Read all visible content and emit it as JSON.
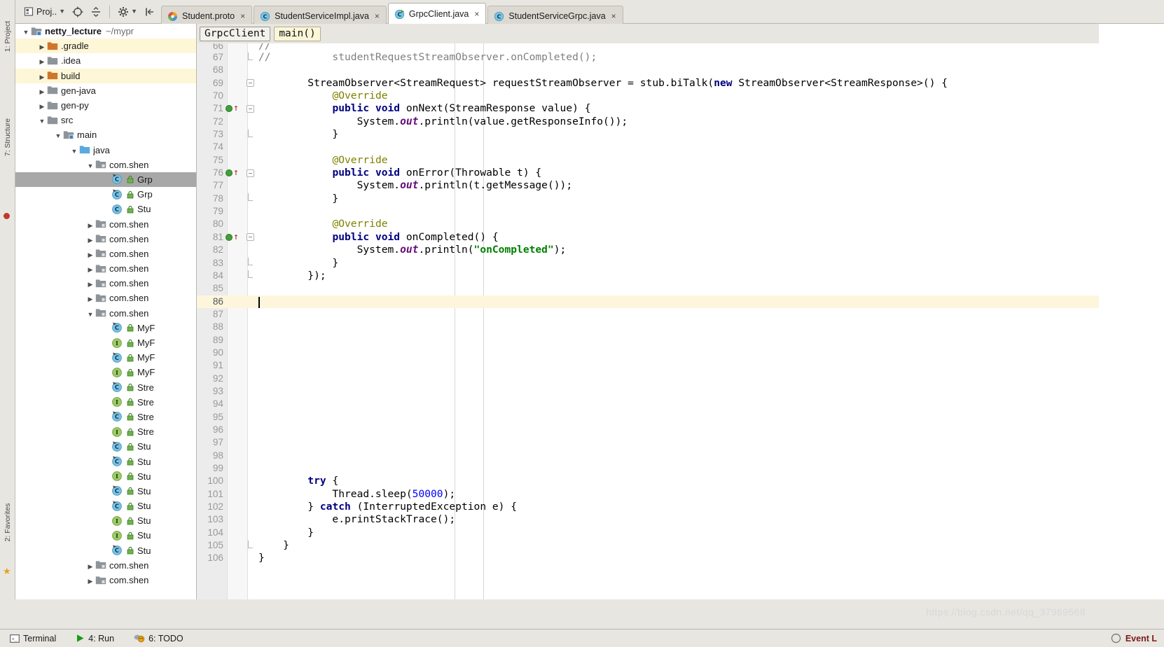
{
  "toolbar": {
    "project_button": "Proj..",
    "buttons": [
      {
        "name": "project-dropdown",
        "label": "Proj..",
        "icon": "project-icon"
      },
      {
        "name": "target-button",
        "label": "",
        "icon": "target-icon"
      },
      {
        "name": "collapse-button",
        "label": "",
        "icon": "collapse-icon"
      },
      {
        "name": "settings-button",
        "label": "",
        "icon": "gear-icon"
      },
      {
        "name": "hide-button",
        "label": "",
        "icon": "hide-panel-icon"
      }
    ]
  },
  "tabs": [
    {
      "label": "Student.proto",
      "icon": "proto-icon",
      "active": false,
      "close": "×"
    },
    {
      "label": "StudentServiceImpl.java",
      "icon": "class-icon",
      "active": false,
      "close": "×"
    },
    {
      "label": "GrpcClient.java",
      "icon": "runnable-class-icon",
      "active": true,
      "close": "×"
    },
    {
      "label": "StudentServiceGrpc.java",
      "icon": "class-icon",
      "active": false,
      "close": "×"
    }
  ],
  "breadcrumb": {
    "class": "GrpcClient",
    "method": "main()"
  },
  "left_strips": {
    "top_label": "1: Project",
    "structure_label": "7: Structure",
    "favorites_label": "2: Favorites"
  },
  "project_tree": [
    {
      "indent": 0,
      "arrow": "▼",
      "icon": "module-folder",
      "label": "netty_lecture",
      "path": "~/mypr",
      "bold": true,
      "state": "normal"
    },
    {
      "indent": 1,
      "arrow": "▶",
      "icon": "folder-orange",
      "label": ".gradle",
      "path": "",
      "bold": false,
      "state": "hl"
    },
    {
      "indent": 1,
      "arrow": "▶",
      "icon": "folder-gray",
      "label": ".idea",
      "path": "",
      "bold": false,
      "state": "normal"
    },
    {
      "indent": 1,
      "arrow": "▶",
      "icon": "folder-orange",
      "label": "build",
      "path": "",
      "bold": false,
      "state": "hl"
    },
    {
      "indent": 1,
      "arrow": "▶",
      "icon": "folder-gray",
      "label": "gen-java",
      "path": "",
      "bold": false,
      "state": "normal"
    },
    {
      "indent": 1,
      "arrow": "▶",
      "icon": "folder-gray",
      "label": "gen-py",
      "path": "",
      "bold": false,
      "state": "normal"
    },
    {
      "indent": 1,
      "arrow": "▼",
      "icon": "folder-gray",
      "label": "src",
      "path": "",
      "bold": false,
      "state": "normal"
    },
    {
      "indent": 2,
      "arrow": "▼",
      "icon": "module-folder",
      "label": "main",
      "path": "",
      "bold": false,
      "state": "normal"
    },
    {
      "indent": 3,
      "arrow": "▼",
      "icon": "folder-blue",
      "label": "java",
      "path": "",
      "bold": false,
      "state": "normal"
    },
    {
      "indent": 4,
      "arrow": "▼",
      "icon": "package-icon",
      "label": "com.shen",
      "path": "",
      "bold": false,
      "state": "normal"
    },
    {
      "indent": 5,
      "arrow": "",
      "icon": "runnable-class-icon",
      "label": "Grp",
      "path": "",
      "bold": false,
      "state": "sel"
    },
    {
      "indent": 5,
      "arrow": "",
      "icon": "runnable-class-icon",
      "label": "Grp",
      "path": "",
      "bold": false,
      "state": "normal"
    },
    {
      "indent": 5,
      "arrow": "",
      "icon": "class-icon",
      "label": "Stu",
      "path": "",
      "bold": false,
      "state": "normal"
    },
    {
      "indent": 4,
      "arrow": "▶",
      "icon": "package-icon",
      "label": "com.shen",
      "path": "",
      "bold": false,
      "state": "normal"
    },
    {
      "indent": 4,
      "arrow": "▶",
      "icon": "package-icon",
      "label": "com.shen",
      "path": "",
      "bold": false,
      "state": "normal"
    },
    {
      "indent": 4,
      "arrow": "▶",
      "icon": "package-icon",
      "label": "com.shen",
      "path": "",
      "bold": false,
      "state": "normal"
    },
    {
      "indent": 4,
      "arrow": "▶",
      "icon": "package-icon",
      "label": "com.shen",
      "path": "",
      "bold": false,
      "state": "normal"
    },
    {
      "indent": 4,
      "arrow": "▶",
      "icon": "package-icon",
      "label": "com.shen",
      "path": "",
      "bold": false,
      "state": "normal"
    },
    {
      "indent": 4,
      "arrow": "▶",
      "icon": "package-icon",
      "label": "com.shen",
      "path": "",
      "bold": false,
      "state": "normal"
    },
    {
      "indent": 4,
      "arrow": "▼",
      "icon": "package-icon",
      "label": "com.shen",
      "path": "",
      "bold": false,
      "state": "normal"
    },
    {
      "indent": 5,
      "arrow": "",
      "icon": "runnable-class-icon",
      "label": "MyF",
      "path": "",
      "bold": false,
      "state": "normal"
    },
    {
      "indent": 5,
      "arrow": "",
      "icon": "interface-icon",
      "label": "MyF",
      "path": "",
      "bold": false,
      "state": "normal"
    },
    {
      "indent": 5,
      "arrow": "",
      "icon": "runnable-class-icon",
      "label": "MyF",
      "path": "",
      "bold": false,
      "state": "normal"
    },
    {
      "indent": 5,
      "arrow": "",
      "icon": "interface-icon",
      "label": "MyF",
      "path": "",
      "bold": false,
      "state": "normal"
    },
    {
      "indent": 5,
      "arrow": "",
      "icon": "runnable-class-icon",
      "label": "Stre",
      "path": "",
      "bold": false,
      "state": "normal"
    },
    {
      "indent": 5,
      "arrow": "",
      "icon": "interface-icon",
      "label": "Stre",
      "path": "",
      "bold": false,
      "state": "normal"
    },
    {
      "indent": 5,
      "arrow": "",
      "icon": "runnable-class-icon",
      "label": "Stre",
      "path": "",
      "bold": false,
      "state": "normal"
    },
    {
      "indent": 5,
      "arrow": "",
      "icon": "interface-icon",
      "label": "Stre",
      "path": "",
      "bold": false,
      "state": "normal"
    },
    {
      "indent": 5,
      "arrow": "",
      "icon": "runnable-class-icon",
      "label": "Stu",
      "path": "",
      "bold": false,
      "state": "normal"
    },
    {
      "indent": 5,
      "arrow": "",
      "icon": "runnable-class-icon",
      "label": "Stu",
      "path": "",
      "bold": false,
      "state": "normal"
    },
    {
      "indent": 5,
      "arrow": "",
      "icon": "interface-icon",
      "label": "Stu",
      "path": "",
      "bold": false,
      "state": "normal"
    },
    {
      "indent": 5,
      "arrow": "",
      "icon": "runnable-class-icon",
      "label": "Stu",
      "path": "",
      "bold": false,
      "state": "normal"
    },
    {
      "indent": 5,
      "arrow": "",
      "icon": "runnable-class-icon",
      "label": "Stu",
      "path": "",
      "bold": false,
      "state": "normal"
    },
    {
      "indent": 5,
      "arrow": "",
      "icon": "interface-icon",
      "label": "Stu",
      "path": "",
      "bold": false,
      "state": "normal"
    },
    {
      "indent": 5,
      "arrow": "",
      "icon": "interface-icon",
      "label": "Stu",
      "path": "",
      "bold": false,
      "state": "normal"
    },
    {
      "indent": 5,
      "arrow": "",
      "icon": "runnable-class-icon",
      "label": "Stu",
      "path": "",
      "bold": false,
      "state": "normal"
    },
    {
      "indent": 4,
      "arrow": "▶",
      "icon": "package-icon",
      "label": "com.shen",
      "path": "",
      "bold": false,
      "state": "normal"
    },
    {
      "indent": 4,
      "arrow": "▶",
      "icon": "package-icon",
      "label": "com.shen",
      "path": "",
      "bold": false,
      "state": "normal"
    }
  ],
  "code": {
    "first_visible_line": 66,
    "cursor_line": 86,
    "lines": [
      {
        "n": 66,
        "gutter": "",
        "fold": "",
        "tokens": [
          {
            "t": "//",
            "c": "cmt",
            "indent": 0
          }
        ],
        "partial": true
      },
      {
        "n": 67,
        "gutter": "",
        "fold": "fold-end",
        "tokens": [
          {
            "t": "//          studentRequestStreamObserver.onCompleted();",
            "c": "cmt",
            "indent": 0
          }
        ]
      },
      {
        "n": 68,
        "gutter": "",
        "fold": "",
        "tokens": []
      },
      {
        "n": 69,
        "gutter": "",
        "fold": "fold-open",
        "raw": "        StreamObserver<StreamRequest> requestStreamObserver = stub.biTalk(new StreamObserver<StreamResponse>() {"
      },
      {
        "n": 70,
        "gutter": "",
        "fold": "",
        "raw": "            @Override"
      },
      {
        "n": 71,
        "gutter": "run-override",
        "fold": "fold-open",
        "raw": "            public void onNext(StreamResponse value) {"
      },
      {
        "n": 72,
        "gutter": "",
        "fold": "",
        "raw": "                System.out.println(value.getResponseInfo());"
      },
      {
        "n": 73,
        "gutter": "",
        "fold": "fold-end",
        "raw": "            }"
      },
      {
        "n": 74,
        "gutter": "",
        "fold": "",
        "raw": ""
      },
      {
        "n": 75,
        "gutter": "",
        "fold": "",
        "raw": "            @Override"
      },
      {
        "n": 76,
        "gutter": "run-override",
        "fold": "fold-open",
        "raw": "            public void onError(Throwable t) {"
      },
      {
        "n": 77,
        "gutter": "",
        "fold": "",
        "raw": "                System.out.println(t.getMessage());"
      },
      {
        "n": 78,
        "gutter": "",
        "fold": "fold-end",
        "raw": "            }"
      },
      {
        "n": 79,
        "gutter": "",
        "fold": "",
        "raw": ""
      },
      {
        "n": 80,
        "gutter": "",
        "fold": "",
        "raw": "            @Override"
      },
      {
        "n": 81,
        "gutter": "run-override",
        "fold": "fold-open",
        "raw": "            public void onCompleted() {"
      },
      {
        "n": 82,
        "gutter": "",
        "fold": "",
        "raw": "                System.out.println(\"onCompleted\");"
      },
      {
        "n": 83,
        "gutter": "",
        "fold": "fold-end",
        "raw": "            }"
      },
      {
        "n": 84,
        "gutter": "",
        "fold": "fold-end",
        "raw": "        });"
      },
      {
        "n": 85,
        "gutter": "",
        "fold": "",
        "raw": ""
      },
      {
        "n": 86,
        "gutter": "",
        "fold": "",
        "raw": "        ",
        "cursor": true
      },
      {
        "n": 87,
        "gutter": "",
        "fold": "",
        "raw": ""
      },
      {
        "n": 88,
        "gutter": "",
        "fold": "",
        "raw": ""
      },
      {
        "n": 89,
        "gutter": "",
        "fold": "",
        "raw": ""
      },
      {
        "n": 90,
        "gutter": "",
        "fold": "",
        "raw": ""
      },
      {
        "n": 91,
        "gutter": "",
        "fold": "",
        "raw": ""
      },
      {
        "n": 92,
        "gutter": "",
        "fold": "",
        "raw": ""
      },
      {
        "n": 93,
        "gutter": "",
        "fold": "",
        "raw": ""
      },
      {
        "n": 94,
        "gutter": "",
        "fold": "",
        "raw": ""
      },
      {
        "n": 95,
        "gutter": "",
        "fold": "",
        "raw": ""
      },
      {
        "n": 96,
        "gutter": "",
        "fold": "",
        "raw": ""
      },
      {
        "n": 97,
        "gutter": "",
        "fold": "",
        "raw": ""
      },
      {
        "n": 98,
        "gutter": "",
        "fold": "",
        "raw": ""
      },
      {
        "n": 99,
        "gutter": "",
        "fold": "",
        "raw": ""
      },
      {
        "n": 100,
        "gutter": "",
        "fold": "",
        "raw": "        try {"
      },
      {
        "n": 101,
        "gutter": "",
        "fold": "",
        "raw": "            Thread.sleep(50000);"
      },
      {
        "n": 102,
        "gutter": "",
        "fold": "",
        "raw": "        } catch (InterruptedException e) {"
      },
      {
        "n": 103,
        "gutter": "",
        "fold": "",
        "raw": "            e.printStackTrace();"
      },
      {
        "n": 104,
        "gutter": "",
        "fold": "",
        "raw": "        }"
      },
      {
        "n": 105,
        "gutter": "",
        "fold": "fold-end",
        "raw": "    }"
      },
      {
        "n": 106,
        "gutter": "",
        "fold": "",
        "raw": "}"
      }
    ]
  },
  "statusbar": {
    "items": [
      {
        "label": "Terminal",
        "icon": "terminal-icon"
      },
      {
        "label": "4: Run",
        "icon": "run-icon"
      },
      {
        "label": "6: TODO",
        "icon": "todo-icon"
      }
    ],
    "event_log": "Event L",
    "watermark": "https://blog.csdn.net/qq_37969568"
  },
  "colors": {
    "accent_keyword": "#000080",
    "string": "#008000",
    "comment": "#808080",
    "annotation": "#808000",
    "static_field": "#660e7a",
    "number": "#0000ff",
    "cursor_line_bg": "#fdf6dd",
    "selection_bg": "#a8a8a8",
    "panel_bg": "#e8e6e1"
  }
}
